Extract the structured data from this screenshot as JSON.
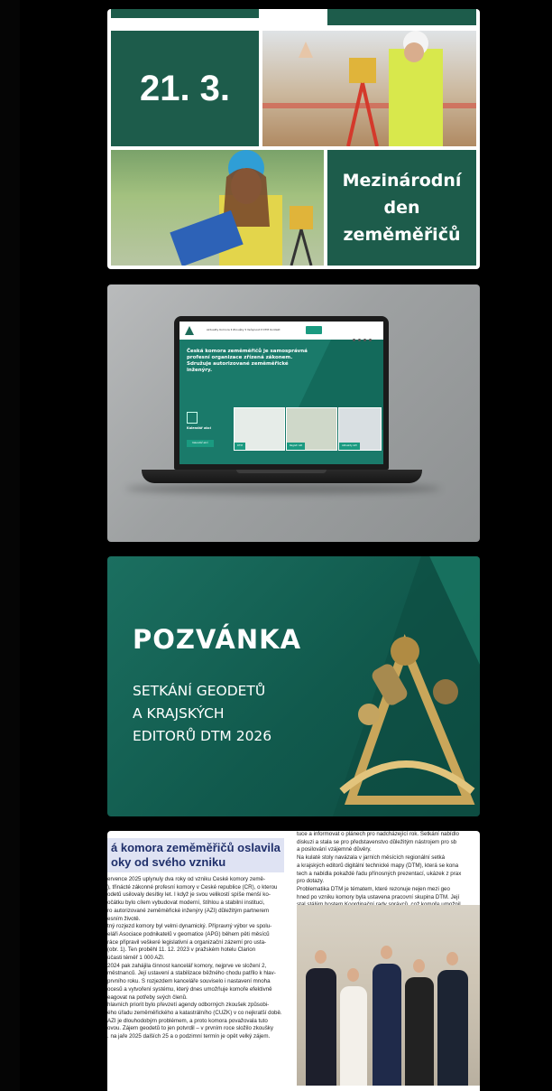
{
  "card_event": {
    "date": "21. 3.",
    "title_lines": [
      "Mezinárodní",
      "den",
      "zeměměřičů"
    ],
    "colors": {
      "green": "#1d5c4b"
    }
  },
  "card_website": {
    "site_nav": "Aktuality  Komora ▾  Zkoušky ▾  Veřejnost ▾  DTM  Kontakt",
    "hero_text": "Česká komora zeměměřičů je samosprávná profesní organizace zřízená zákonem. Sdružuje autorizované zeměměřické inženýry.",
    "calendar_label": "Kalendář akcí",
    "calendar_button": "Kalendář akcí",
    "thumbs": [
      "DTM",
      "Registr AZI",
      "Aktuality AZI"
    ]
  },
  "card_invite": {
    "title": "POZVÁNKA",
    "subtitle_lines": [
      "SETKÁNÍ GEODETŮ",
      "A KRAJSKÝCH",
      "EDITORŮ DTM 2026"
    ]
  },
  "card_article": {
    "heading_lines": [
      "á komora zeměměřičů oslavila",
      "oky od svého vzniku"
    ],
    "left_paragraphs": [
      "ervence 2025 uplynuly dva roky od vzniku České komory země-",
      "), třinácté zákonné profesní komory v České republice (ČR), o kterou",
      "odetů usilovaly desítky let. I když je svou velikostí spíše menší ko-",
      "očátku bylo cílem vybudovat moderní, štíhlou a stabilní instituci,",
      "ro autorizované zeměměřické inženýry (AZI) důležitým partnerem",
      "esním životě.",
      "tný rozjezd komory byl velmi dynamický. Přípravný výbor ve spolu-",
      "eláři Asociace podnikatelů v geomatice (APG) během pěti měsíců",
      "ráce připravil veškeré legislativní a organizační zázemí pro usta-",
      "(obr. 1). Ten proběhl 11. 12. 2023 v pražském hotelu Clarion",
      "účasti téměř 1 000 AZI.",
      "2024 pak zahájila činnost kancelář komory, nejprve ve složení 2,",
      "městnanců. Její ustavení a stabilizace běžného chodu patřilo k hlav-",
      "prvního roku. S rozjezdem kanceláře souviselo i nastavení mnoha",
      "ocesů a vytvoření systému, který dnes umožňuje komoře efektivně",
      "eagovat na potřeby svých členů.",
      "hlavních priorit bylo převzetí agendy odborných zkoušek způsobi-",
      "ého úřadu zeměměřického a katastrálního (ČÚZK) v co nejkratší době.",
      "AZI je dlouhodobým problémem, a proto komora považovala tuto",
      "ovou. Zájem geodetů to jen potvrdil – v prvním roce složilo zkoušky",
      ". na jaře 2025 dalších 25 a o podzimní termín je opět velký zájem."
    ],
    "right_paragraphs": [
      "tuce a informovat o plánech pro nadcházející rok. Setkání nabídlo",
      "diskuzi a stala se pro představenstvo důležitým nástrojem pro sb",
      "a posilování vzájemné důvěry.",
      "Na kulaté stoly navázala v jarních měsících regionální setká",
      "a krajských editorů digitální technické mapy (DTM), která se kona",
      "tech a nabídla pokaždé řadu přínosných prezentací, ukázek z prax",
      "pro dotazy.",
      "Problematika DTM je tématem, které rezonuje nejen mezi geo",
      "hned po vzniku komory byla ustavena pracovní skupina DTM. Její",
      "stal stálým hostem Koordinační rady správců, což komoře umožnil",
      "podílet na rozvoji DTM i Digitální mapy veřejné správy (DMVS). Ko",
      "veň poskytla odbornou garanci při tvorbě osvětových videí k DTM"
    ]
  }
}
